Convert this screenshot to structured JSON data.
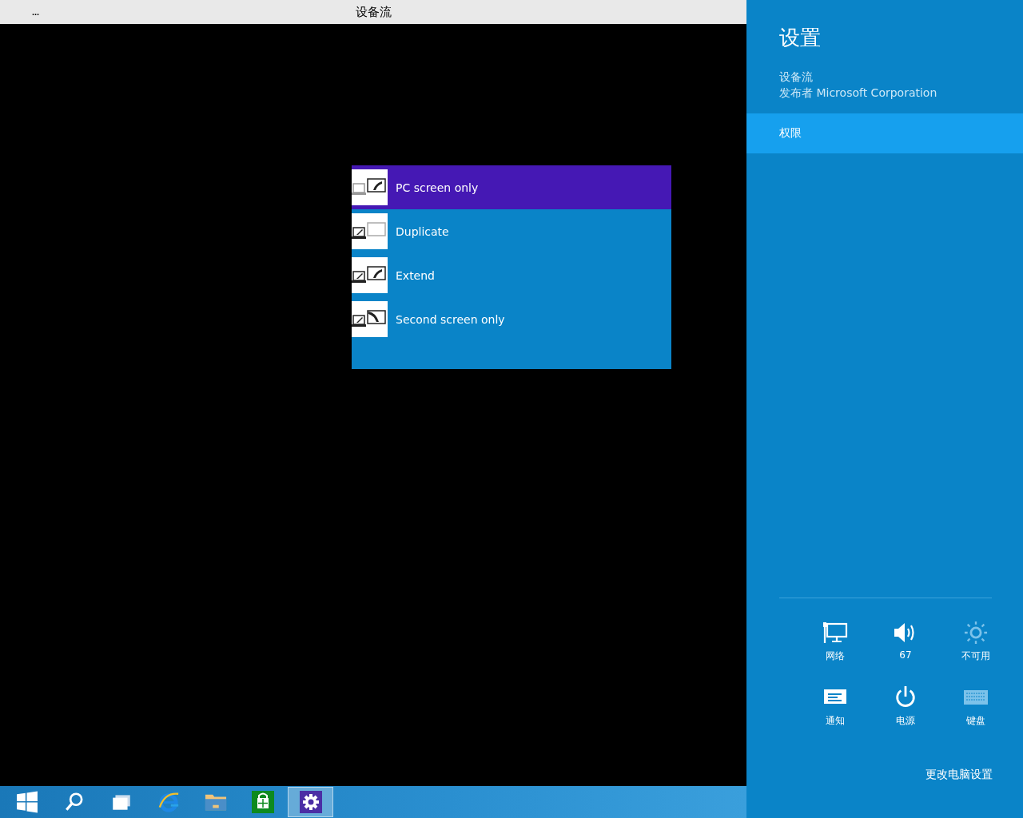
{
  "app_window": {
    "menu_glyph": "...",
    "title": "设备流"
  },
  "project_menu": {
    "items": [
      {
        "kind": "pc_only",
        "label": "PC screen only",
        "selected": true
      },
      {
        "kind": "duplicate",
        "label": "Duplicate",
        "selected": false
      },
      {
        "kind": "extend",
        "label": "Extend",
        "selected": false
      },
      {
        "kind": "second_only",
        "label": "Second screen only",
        "selected": false
      }
    ]
  },
  "taskbar": {
    "items": [
      {
        "kind": "start",
        "selected": false
      },
      {
        "kind": "search",
        "selected": false
      },
      {
        "kind": "task_view",
        "selected": false
      },
      {
        "kind": "browser",
        "selected": false
      },
      {
        "kind": "folder",
        "selected": false
      },
      {
        "kind": "store",
        "selected": false
      },
      {
        "kind": "settings",
        "selected": true
      }
    ]
  },
  "settings_pane": {
    "title": "设置",
    "app_name": "设备流",
    "publisher": "发布者 Microsoft Corporation",
    "items": [
      {
        "label": "权限",
        "selected": true
      }
    ],
    "quick_settings": [
      {
        "kind": "network",
        "label": "网络",
        "disabled": false
      },
      {
        "kind": "volume",
        "label": "67",
        "disabled": false
      },
      {
        "kind": "brightness",
        "label": "不可用",
        "disabled": true
      },
      {
        "kind": "notifications",
        "label": "通知",
        "disabled": false
      },
      {
        "kind": "power",
        "label": "电源",
        "disabled": false
      },
      {
        "kind": "keyboard",
        "label": "键盘",
        "disabled": true
      }
    ],
    "change_pc_settings": "更改电脑设置"
  }
}
